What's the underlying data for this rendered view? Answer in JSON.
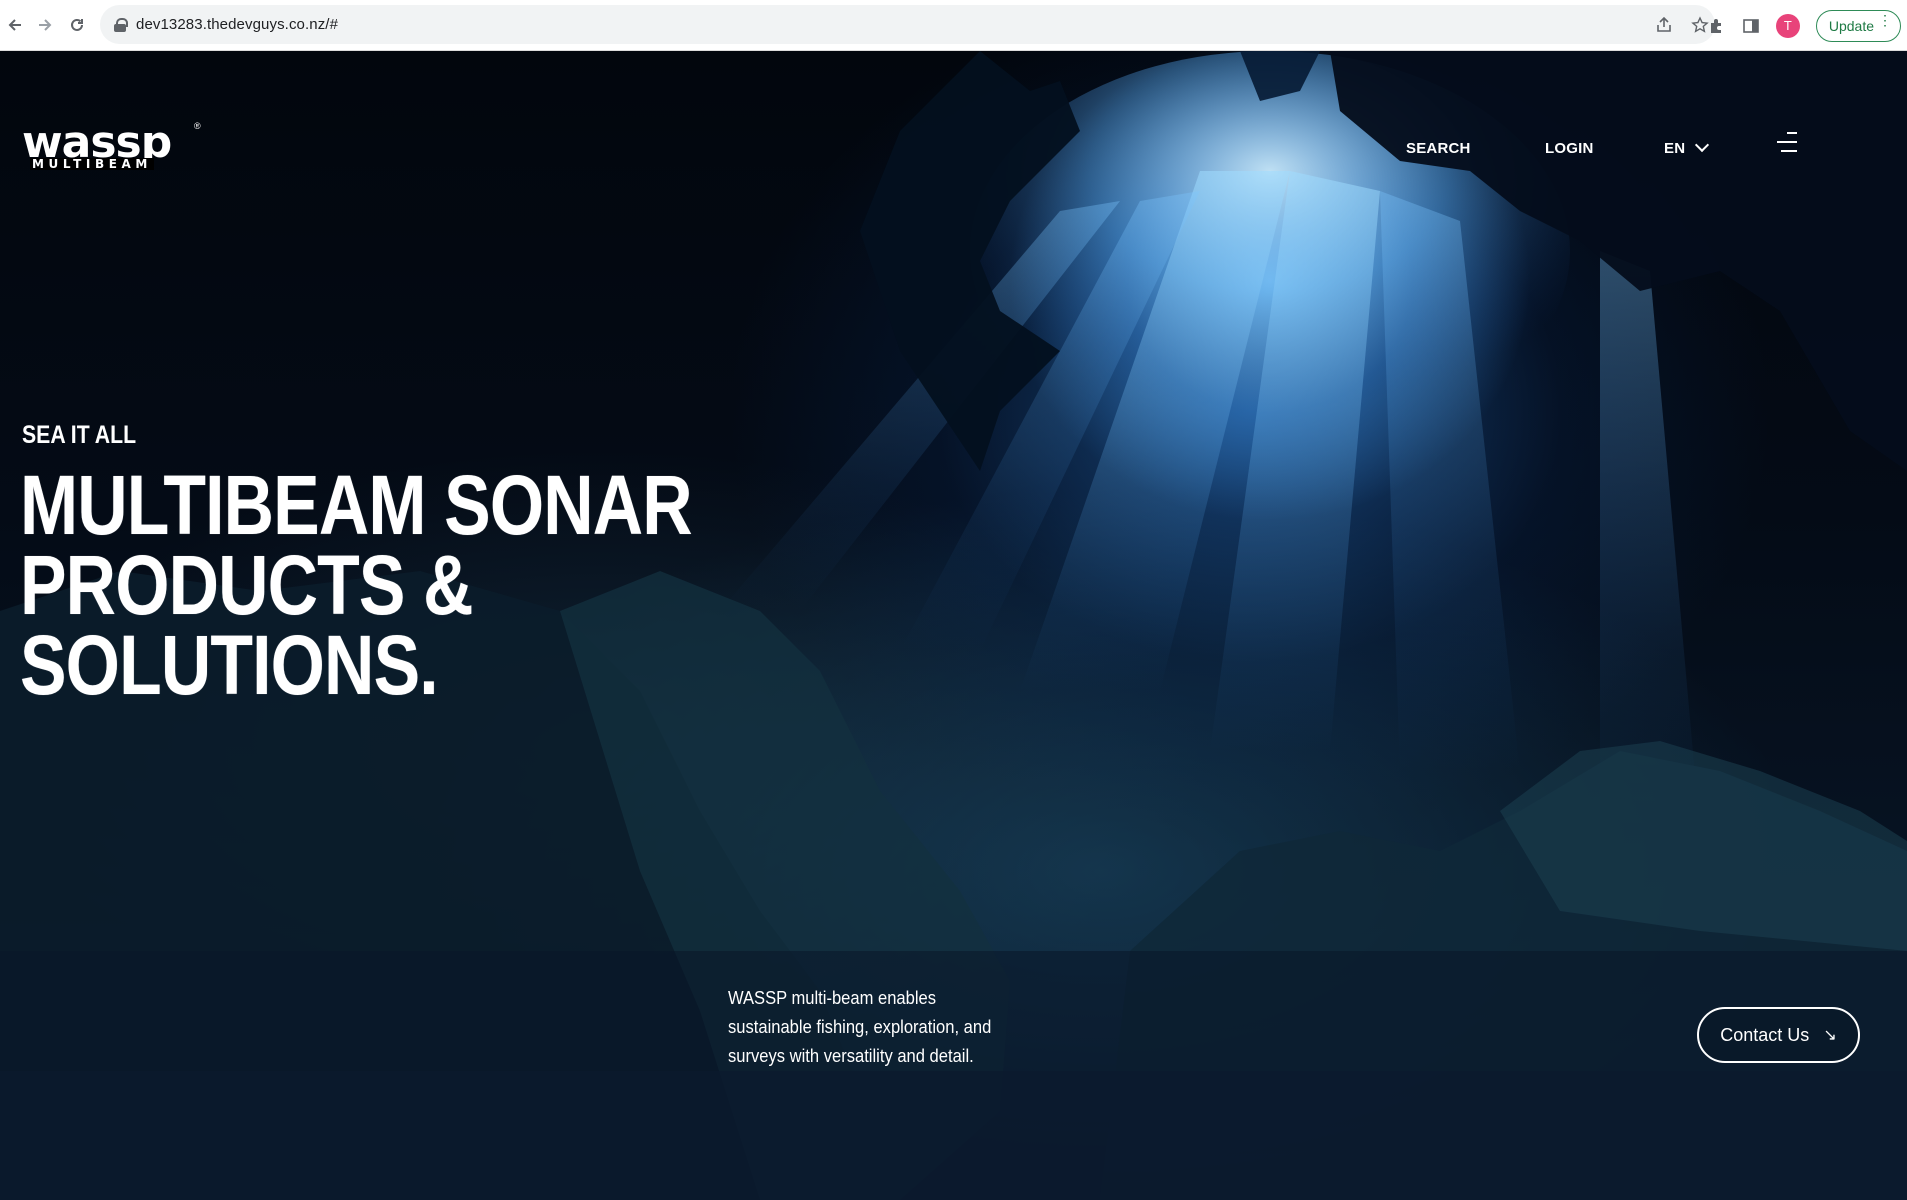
{
  "browser": {
    "url": "dev13283.thedevguys.co.nz/#",
    "back_icon": "arrow-left-icon",
    "forward_icon": "arrow-right-icon",
    "reload_icon": "reload-icon",
    "avatar_initial": "T",
    "update_label": "Update"
  },
  "site": {
    "logo_text": "wassp",
    "logo_sub": "MULTIBEAM",
    "logo_reg": "®",
    "nav": {
      "search": "SEARCH",
      "login": "LOGIN",
      "lang": "EN"
    },
    "hero": {
      "kicker": "SEA IT ALL",
      "headline_line1": "MULTIBEAM SONAR PRODUCTS &",
      "headline_line2": "SOLUTIONS.",
      "description": "WASSP multi-beam enables sustainable fishing, exploration, and surveys with versatility and detail.",
      "contact_label": "Contact Us",
      "contact_arrow": "↘"
    }
  },
  "colors": {
    "accent_update": "#2e8b57",
    "avatar": "#e8437a",
    "hero_dark": "#040b16",
    "light_blue": "#8cd2ff"
  }
}
